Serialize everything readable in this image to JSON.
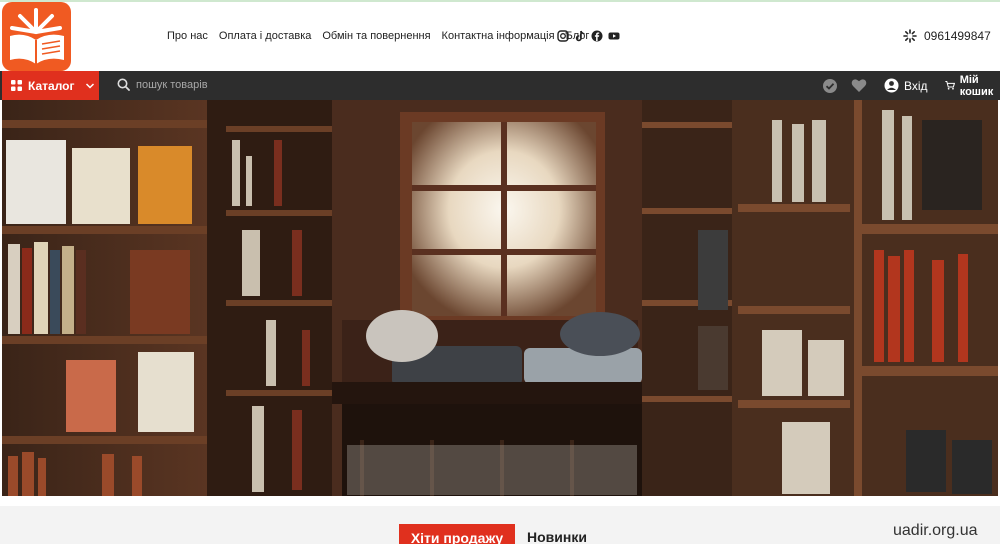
{
  "header": {
    "nav": [
      {
        "label": "Про нас"
      },
      {
        "label": "Оплата і доставка"
      },
      {
        "label": "Обмін та повернення"
      },
      {
        "label": "Контактна інформація"
      },
      {
        "label": "Блог"
      }
    ],
    "socials": [
      "instagram-icon",
      "tiktok-icon",
      "facebook-icon",
      "youtube-icon"
    ],
    "phone": "0961499847"
  },
  "bar": {
    "catalog_label": "Каталог",
    "search_placeholder": "пошук товарів",
    "login_label": "Вхід",
    "cart_label": "Мій кошик"
  },
  "tabs": {
    "hits": "Хіти продажу",
    "new": "Новинки"
  },
  "watermark": "uadir.org.ua",
  "colors": {
    "accent": "#e0301e",
    "logo": "#f05a22",
    "bar": "#2d2d2d"
  }
}
